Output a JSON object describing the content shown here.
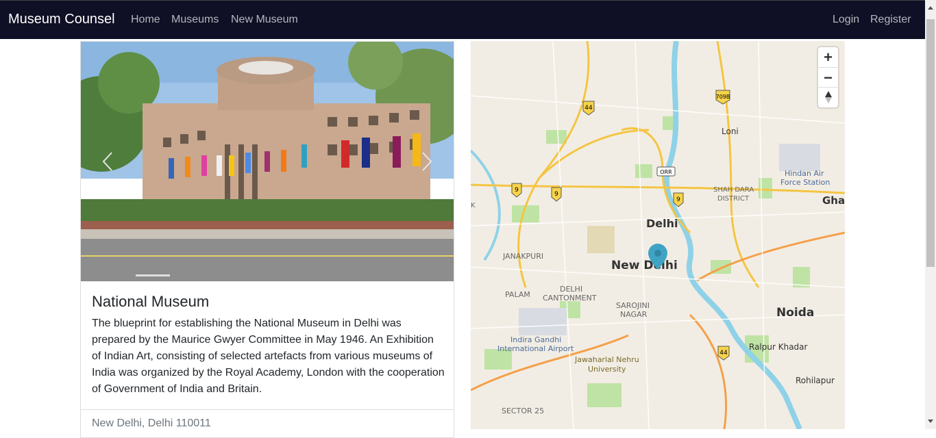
{
  "nav": {
    "brand": "Museum Counsel",
    "links": [
      "Home",
      "Museums",
      "New Museum"
    ],
    "right_links": [
      "Login",
      "Register"
    ]
  },
  "museum": {
    "title": "National Museum",
    "description": "The blueprint for establishing the National Museum in Delhi was prepared by the Maurice Gwyer Committee in May 1946. An Exhibition of Indian Art, consisting of selected artefacts from various museums of India was organized by the Royal Academy, London with the cooperation of Government of India and Britain.",
    "location": "New Delhi, Delhi 110011"
  },
  "map": {
    "zoom_in": "+",
    "zoom_out": "−",
    "labels": {
      "delhi": "Delhi",
      "new_delhi": "New Delhi",
      "noida": "Noida",
      "loni": "Loni",
      "gha": "Gha",
      "janakpuri": "JANAKPURI",
      "palam": "PALAM",
      "delhi_cantonment_1": "DELHI",
      "delhi_cantonment_2": "CANTONMENT",
      "sarojini_1": "SAROJINI",
      "sarojini_2": "NAGAR",
      "shahdara_1": "SHAH DARA",
      "shahdara_2": "DISTRICT",
      "hindan_1": "Hindan Air",
      "hindan_2": "Force Station",
      "airport_1": "Indira Gandhi",
      "airport_2": "International Airport",
      "jnu_1": "Jawaharlal Nehru",
      "jnu_2": "University",
      "ralpur": "Ralpur Khadar",
      "rohilapur": "Rohilapur",
      "sector25": "SECTOR 25",
      "k": "K",
      "orr": "ORR",
      "shield_44": "44",
      "shield_9": "9",
      "shield_709b": "709B"
    }
  },
  "colors": {
    "navbar": "#0f0f25",
    "marker": "#3fa3c4",
    "road_yellow": "#f4c542",
    "river": "#8fd2e8",
    "park": "#bfe3a4"
  }
}
